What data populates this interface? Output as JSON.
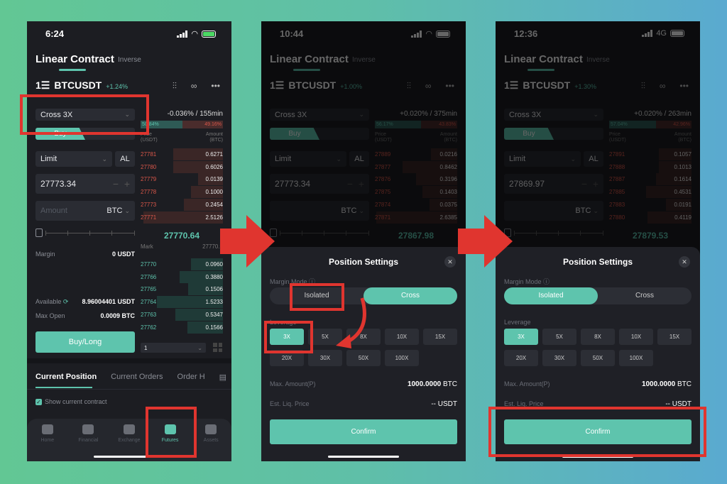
{
  "colors": {
    "accent": "#5ec4ad",
    "ask": "#d9574a",
    "highlight": "#e0352f",
    "background": "#1c1d22"
  },
  "phones": [
    {
      "status": {
        "time": "6:24",
        "network": "wifi",
        "battery": "charging"
      },
      "header": {
        "title": "Linear Contract",
        "inverse": "Inverse"
      },
      "symbol": {
        "name": "BTCUSDT",
        "change": "+1.24%",
        "icons": [
          "chart-icon",
          "link-icon",
          "more-icon"
        ]
      },
      "menu_icon_text": "1☰",
      "form": {
        "margin_select": "Cross  3X",
        "buy_tab": "Buy",
        "order_type": "Limit",
        "al": "AL",
        "price": "27773.34",
        "amount_placeholder": "Amount",
        "amount_unit": "BTC",
        "margin_label": "Margin",
        "margin_value": "0 USDT",
        "available_label": "Available",
        "available_value": "8.96004401 USDT",
        "max_open_label": "Max Open",
        "max_open_value": "0.0009 BTC",
        "buy_long": "Buy/Long"
      },
      "orderbook": {
        "funding": "-0.036% / 155min",
        "buy_ratio": "50.84%",
        "sell_ratio": "49.16%",
        "buy_ratio_value": 50.84,
        "price_header": "Price\n(USDT)",
        "amount_header": "Amount\n(BTC)",
        "asks": [
          {
            "p": "27781",
            "a": "0.6271"
          },
          {
            "p": "27780",
            "a": "0.6026"
          },
          {
            "p": "27779",
            "a": "0.0139"
          },
          {
            "p": "27778",
            "a": "0.1000"
          },
          {
            "p": "27773",
            "a": "0.2454"
          },
          {
            "p": "27771",
            "a": "2.5126"
          }
        ],
        "mid": "27770.64",
        "mark_label": "Mark",
        "mark_value": "27770.9",
        "bids": [
          {
            "p": "27770",
            "a": "0.0960"
          },
          {
            "p": "27766",
            "a": "0.3880"
          },
          {
            "p": "27765",
            "a": "0.1506"
          },
          {
            "p": "27764",
            "a": "1.5233"
          },
          {
            "p": "27763",
            "a": "0.5347"
          },
          {
            "p": "27762",
            "a": "0.1566"
          }
        ],
        "depth": "1"
      },
      "bottom_tabs": {
        "items": [
          "Current Position",
          "Current Orders",
          "Order H"
        ],
        "show_current": "Show current contract"
      },
      "nav": [
        {
          "label": "Home"
        },
        {
          "label": "Financial"
        },
        {
          "label": "Exchange"
        },
        {
          "label": "Futures",
          "active": true
        },
        {
          "label": "Assets"
        }
      ]
    },
    {
      "status": {
        "time": "10:44",
        "network": "wifi",
        "battery": "full"
      },
      "header": {
        "title": "Linear Contract",
        "inverse": "Inverse"
      },
      "symbol": {
        "name": "BTCUSDT",
        "change": "+1.00%",
        "icons": [
          "chart-icon",
          "link-icon",
          "more-icon"
        ]
      },
      "menu_icon_text": "1☰",
      "form": {
        "margin_select": "Cross  3X",
        "buy_tab": "Buy",
        "order_type": "Limit",
        "al": "AL",
        "price": "27773.34",
        "amount_placeholder": "",
        "amount_unit": "BTC"
      },
      "orderbook": {
        "funding": "+0.020% / 375min",
        "buy_ratio": "56.17%",
        "sell_ratio": "43.83%",
        "buy_ratio_value": 56.17,
        "price_header": "Price\n(USDT)",
        "amount_header": "Amount\n(BTC)",
        "asks": [
          {
            "p": "27889",
            "a": "0.0216"
          },
          {
            "p": "27877",
            "a": "0.8462"
          },
          {
            "p": "27876",
            "a": "0.3196"
          },
          {
            "p": "27875",
            "a": "0.1403"
          },
          {
            "p": "27874",
            "a": "0.0375"
          },
          {
            "p": "27871",
            "a": "2.6385"
          }
        ],
        "mid": "27867.98"
      },
      "modal": {
        "title": "Position Settings",
        "margin_mode_label": "Margin Mode",
        "modes": [
          "Isolated",
          "Cross"
        ],
        "active_mode": "Cross",
        "leverage_label": "Leverage",
        "leverage": [
          "3X",
          "5X",
          "8X",
          "10X",
          "15X",
          "20X",
          "30X",
          "50X",
          "100X"
        ],
        "active_leverage": "3X",
        "max_amount_label": "Max. Amount(P)",
        "max_amount_value": "1000.0000",
        "max_amount_unit": "BTC",
        "liq_label": "Est. Liq. Price",
        "liq_value": "-- USDT",
        "confirm": "Confirm"
      }
    },
    {
      "status": {
        "time": "12:36",
        "network": "4G",
        "battery": "full"
      },
      "header": {
        "title": "Linear Contract",
        "inverse": "Inverse"
      },
      "symbol": {
        "name": "BTCUSDT",
        "change": "+1.30%",
        "icons": [
          "chart-icon",
          "link-icon",
          "more-icon"
        ]
      },
      "menu_icon_text": "1☰",
      "form": {
        "margin_select": "Cross  3X",
        "buy_tab": "Buy",
        "order_type": "Limit",
        "al": "AL",
        "price": "27869.97",
        "amount_placeholder": "",
        "amount_unit": "BTC"
      },
      "orderbook": {
        "funding": "+0.020% / 263min",
        "buy_ratio": "57.04%",
        "sell_ratio": "42.96%",
        "buy_ratio_value": 57.04,
        "price_header": "Price\n(USDT)",
        "amount_header": "Amount\n(BTC)",
        "asks": [
          {
            "p": "27891",
            "a": "0.1057"
          },
          {
            "p": "27888",
            "a": "0.1013"
          },
          {
            "p": "27887",
            "a": "0.1614"
          },
          {
            "p": "27885",
            "a": "0.4531"
          },
          {
            "p": "27883",
            "a": "0.0191"
          },
          {
            "p": "27880",
            "a": "0.4119"
          }
        ],
        "mid": "27879.53"
      },
      "modal": {
        "title": "Position Settings",
        "margin_mode_label": "Margin Mode",
        "modes": [
          "Isolated",
          "Cross"
        ],
        "active_mode": "Isolated",
        "leverage_label": "Leverage",
        "leverage": [
          "3X",
          "5X",
          "8X",
          "10X",
          "15X",
          "20X",
          "30X",
          "50X",
          "100X"
        ],
        "active_leverage": "3X",
        "max_amount_label": "Max. Amount(P)",
        "max_amount_value": "1000.0000",
        "max_amount_unit": "BTC",
        "liq_label": "Est. Liq. Price",
        "liq_value": "-- USDT",
        "confirm": "Confirm"
      }
    }
  ]
}
